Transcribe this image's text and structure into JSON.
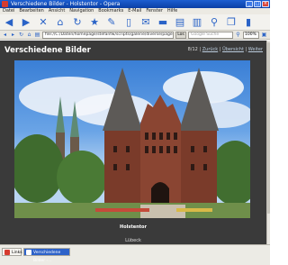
{
  "window": {
    "title": "Verschiedene Bilder - Holstentor - Opera",
    "controls": [
      "_",
      "□",
      "×"
    ]
  },
  "menu": [
    "Datei",
    "Bearbeiten",
    "Ansicht",
    "Navigation",
    "Bookmarks",
    "E-Mail",
    "Fenster",
    "Hilfe"
  ],
  "toolbar_icons": [
    "back-icon",
    "forward-icon",
    "stop-icon",
    "home-icon",
    "reload-icon",
    "bookmark-star-icon",
    "edit-icon",
    "new-page-icon",
    "mail-icon",
    "folder-icon",
    "save-icon",
    "print-icon",
    "search-icon",
    "copy-icon",
    "page-icon"
  ],
  "address": {
    "url": "file://C:/Daten/homepage/stefanfw/scripts/galerie/diverse/page0006.htm",
    "go_label": "Los",
    "search_placeholder": "Google Suche",
    "zoom": "100%"
  },
  "page": {
    "title": "Verschiedene Bilder",
    "counter": "8/12",
    "nav_back": "Zurück",
    "nav_overview": "Übersicht",
    "nav_next": "Weiter",
    "caption": "Holstentor",
    "subcaption": "Lübeck"
  },
  "tabs": [
    {
      "label": "Links"
    },
    {
      "label": "Verschiedene Bilder -..."
    }
  ]
}
